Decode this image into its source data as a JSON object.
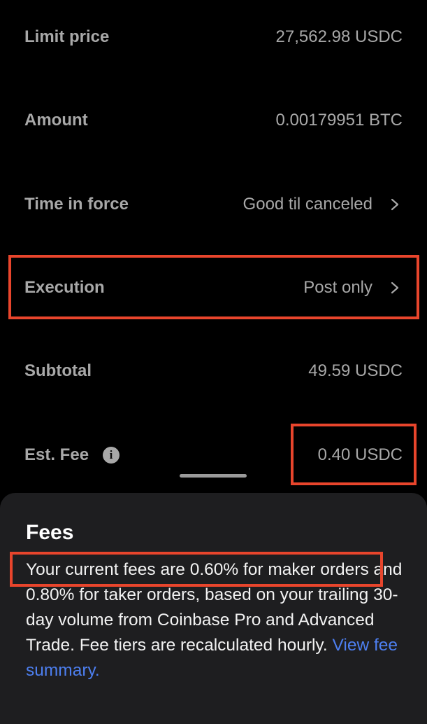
{
  "rows": {
    "limit_price": {
      "label": "Limit price",
      "value": "27,562.98 USDC"
    },
    "amount": {
      "label": "Amount",
      "value": "0.00179951 BTC"
    },
    "time_in_force": {
      "label": "Time in force",
      "value": "Good til canceled"
    },
    "execution": {
      "label": "Execution",
      "value": "Post only"
    },
    "subtotal": {
      "label": "Subtotal",
      "value": "49.59 USDC"
    },
    "est_fee": {
      "label": "Est. Fee",
      "value": "0.40 USDC",
      "info_icon": "info-icon"
    }
  },
  "sheet": {
    "title": "Fees",
    "body_line1": "Your current fees are 0.60% for maker",
    "body_rest": " orders and 0.80% for taker orders, based on your trailing 30-day volume from Coinbase Pro and Advanced Trade. Fee tiers are recalculated hourly. ",
    "link": "View fee summary."
  },
  "colors": {
    "background": "#000000",
    "sheet_background": "#1e1e20",
    "highlight": "#e8452c",
    "link": "#4d7ff0",
    "muted_text": "#a8a8a8"
  }
}
